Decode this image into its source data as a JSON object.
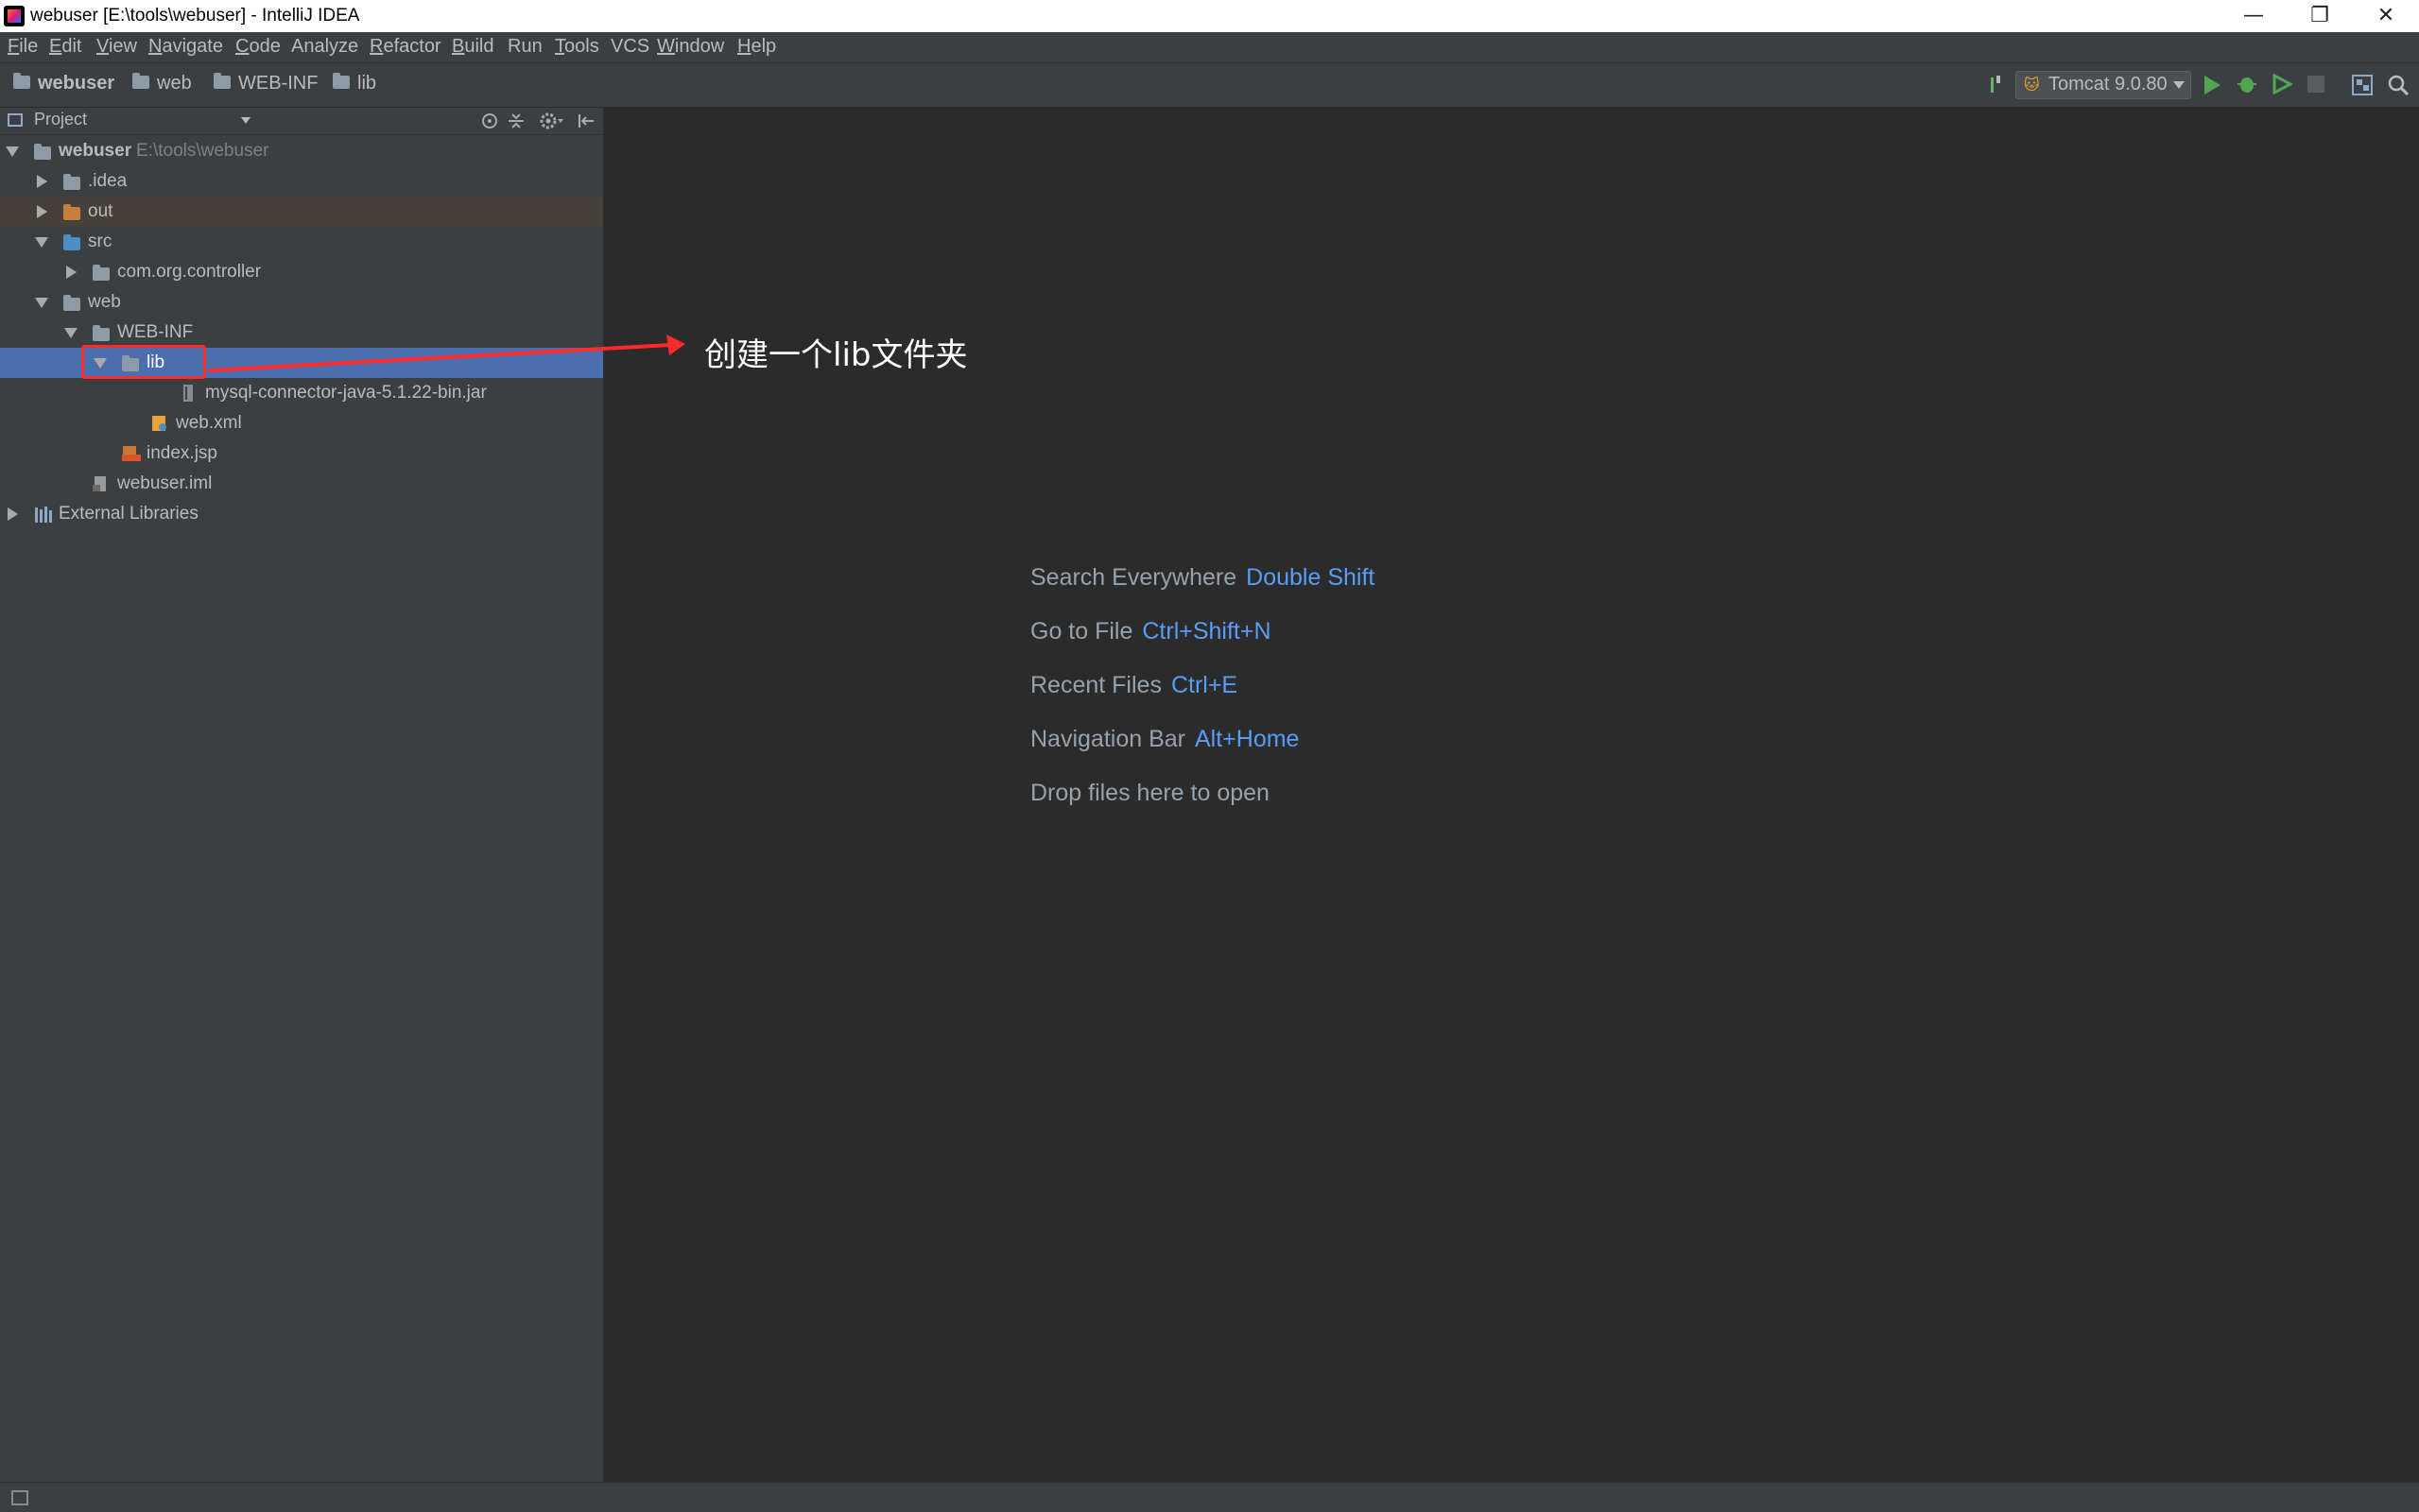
{
  "window": {
    "title": "webuser [E:\\tools\\webuser] - IntelliJ IDEA",
    "minimize": "—",
    "restore": "❐",
    "close": "✕"
  },
  "menu": [
    {
      "u": "F",
      "rest": "ile"
    },
    {
      "u": "E",
      "rest": "dit"
    },
    {
      "u": "V",
      "rest": "iew"
    },
    {
      "u": "N",
      "rest": "avigate"
    },
    {
      "u": "C",
      "rest": "ode"
    },
    {
      "u": "",
      "rest": "Analyze"
    },
    {
      "u": "R",
      "rest": "efactor"
    },
    {
      "u": "B",
      "rest": "uild"
    },
    {
      "u": "",
      "rest": "Run"
    },
    {
      "u": "T",
      "rest": "ools"
    },
    {
      "u": "",
      "rest": "VCS"
    },
    {
      "u": "W",
      "rest": "indow"
    },
    {
      "u": "H",
      "rest": "elp"
    }
  ],
  "breadcrumbs": [
    "webuser",
    "web",
    "WEB-INF",
    "lib"
  ],
  "run_config": "Tomcat 9.0.80",
  "project_panel": {
    "title": "Project",
    "tree": [
      {
        "label": "webuser",
        "hint": "E:\\tools\\webuser",
        "depth": 0,
        "state": "open",
        "icon": "module-icon",
        "bold": true
      },
      {
        "label": ".idea",
        "depth": 1,
        "state": "closed",
        "icon": "folder-icon"
      },
      {
        "label": "out",
        "depth": 1,
        "state": "closed",
        "icon": "folder-icon-orange",
        "highlight": "out"
      },
      {
        "label": "src",
        "depth": 1,
        "state": "open",
        "icon": "folder-icon-blue"
      },
      {
        "label": "com.org.controller",
        "depth": 2,
        "state": "closed",
        "icon": "package-icon"
      },
      {
        "label": "web",
        "depth": 1,
        "state": "open",
        "icon": "folder-icon"
      },
      {
        "label": "WEB-INF",
        "depth": 2,
        "state": "open",
        "icon": "folder-icon"
      },
      {
        "label": "lib",
        "depth": 3,
        "state": "open",
        "icon": "folder-icon",
        "highlight": "selected"
      },
      {
        "label": "mysql-connector-java-5.1.22-bin.jar",
        "depth": 5,
        "state": "none",
        "icon": "jar-icon"
      },
      {
        "label": "web.xml",
        "depth": 4,
        "state": "none",
        "icon": "xml-icon"
      },
      {
        "label": "index.jsp",
        "depth": 3,
        "state": "none",
        "icon": "jsp-icon"
      },
      {
        "label": "webuser.iml",
        "depth": 2,
        "state": "none",
        "icon": "iml-icon"
      },
      {
        "label": "External Libraries",
        "depth": 0,
        "state": "closed",
        "icon": "libraries-icon"
      }
    ]
  },
  "welcome": [
    {
      "label": "Search Everywhere",
      "key": "Double Shift"
    },
    {
      "label": "Go to File",
      "key": "Ctrl+Shift+N"
    },
    {
      "label": "Recent Files",
      "key": "Ctrl+E"
    },
    {
      "label": "Navigation Bar",
      "key": "Alt+Home"
    },
    {
      "label": "Drop files here to open",
      "key": ""
    }
  ],
  "annotation": "创建一个lib文件夹",
  "colors": {
    "selection": "#4b6eaf",
    "out_row": "#45403a",
    "annotation_red": "#ff2a2a",
    "shortcut": "#589df6"
  }
}
